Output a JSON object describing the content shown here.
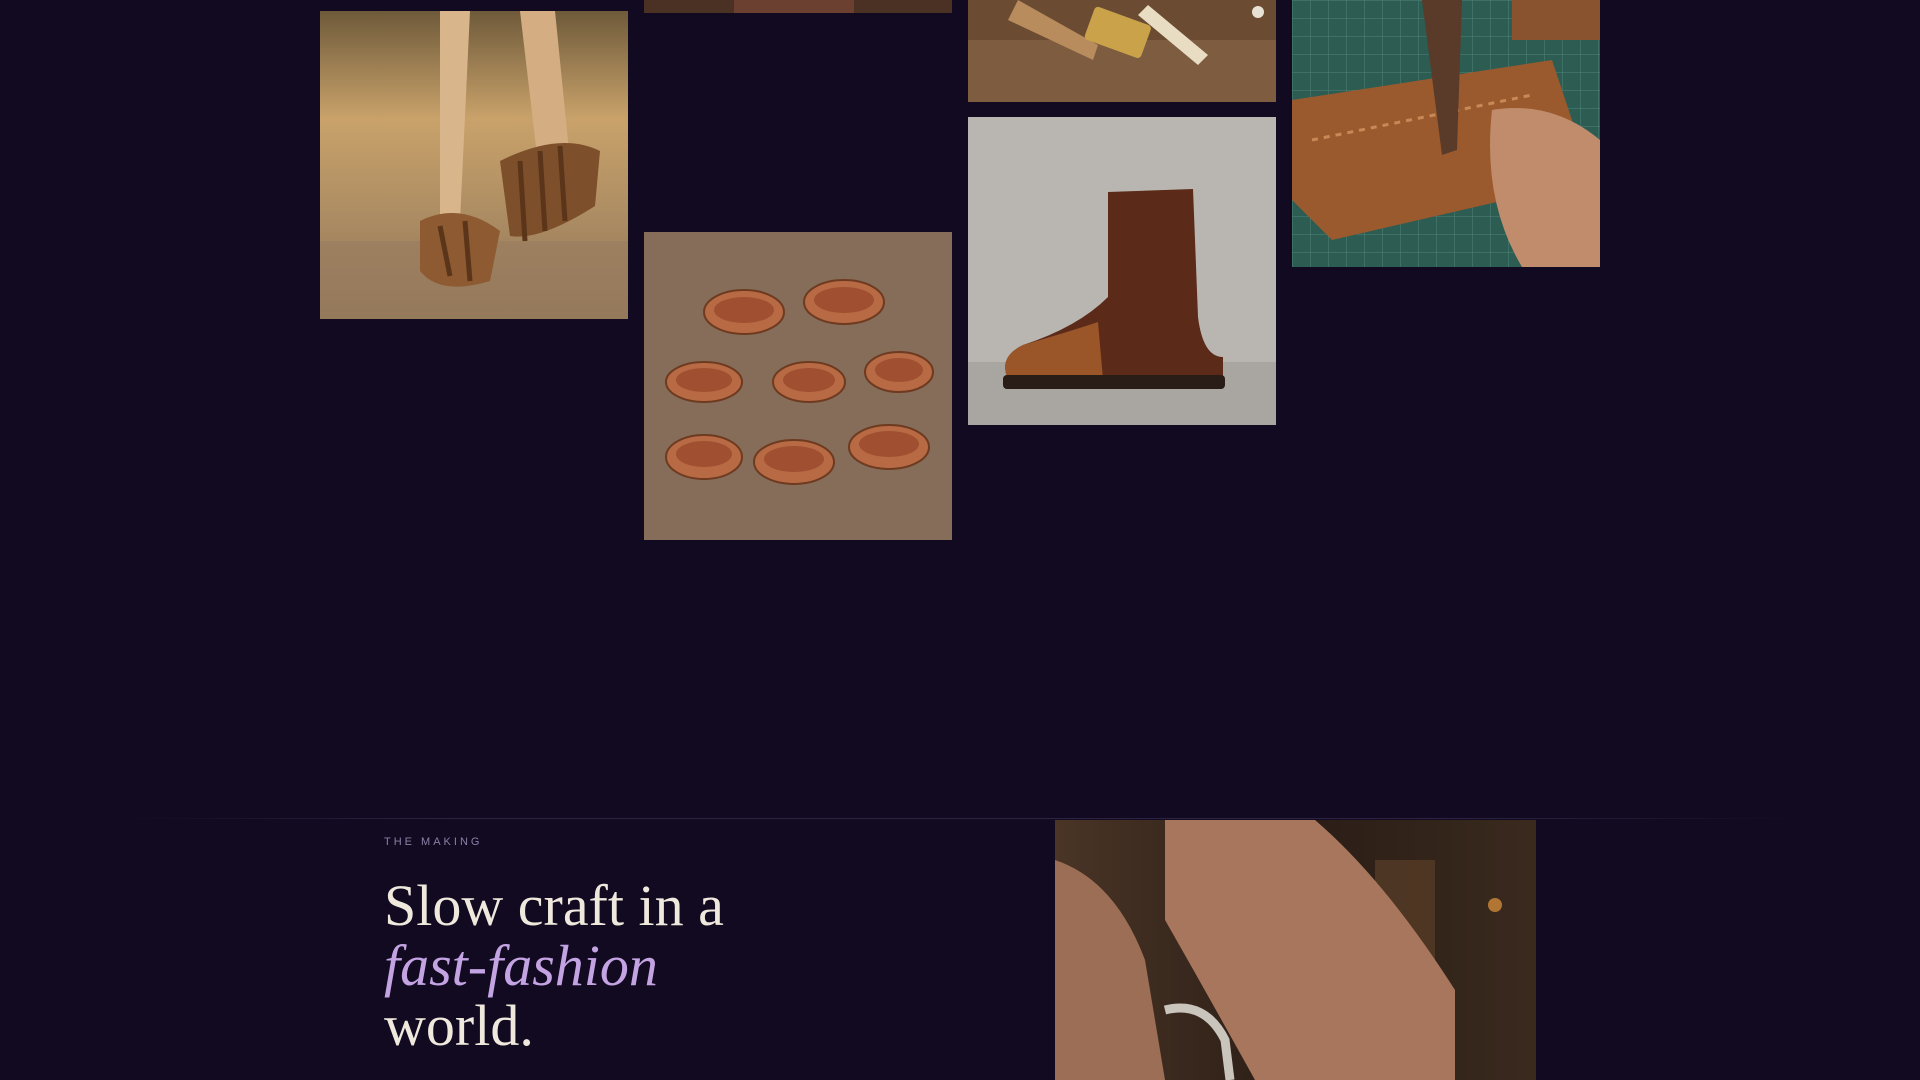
{
  "gallery": {
    "images": [
      {
        "id": "sandals",
        "icon": "sandals-photo"
      },
      {
        "id": "top-strip",
        "icon": "leather-photo"
      },
      {
        "id": "tools",
        "icon": "leather-tools-photo"
      },
      {
        "id": "stitching",
        "icon": "hand-stitching-photo"
      },
      {
        "id": "dye-jars",
        "icon": "leather-dye-jars-photo"
      },
      {
        "id": "boot",
        "icon": "leather-boot-photo"
      }
    ]
  },
  "making": {
    "eyebrow": "THE MAKING",
    "headline_line1": "Slow craft in a",
    "headline_em": "fast-fashion",
    "headline_line3": "world.",
    "image": "craftsman-hands-photo"
  },
  "colors": {
    "background": "#110a21",
    "accent": "#c4a3e3",
    "text": "#efe8dc",
    "muted": "#8a80a8"
  }
}
